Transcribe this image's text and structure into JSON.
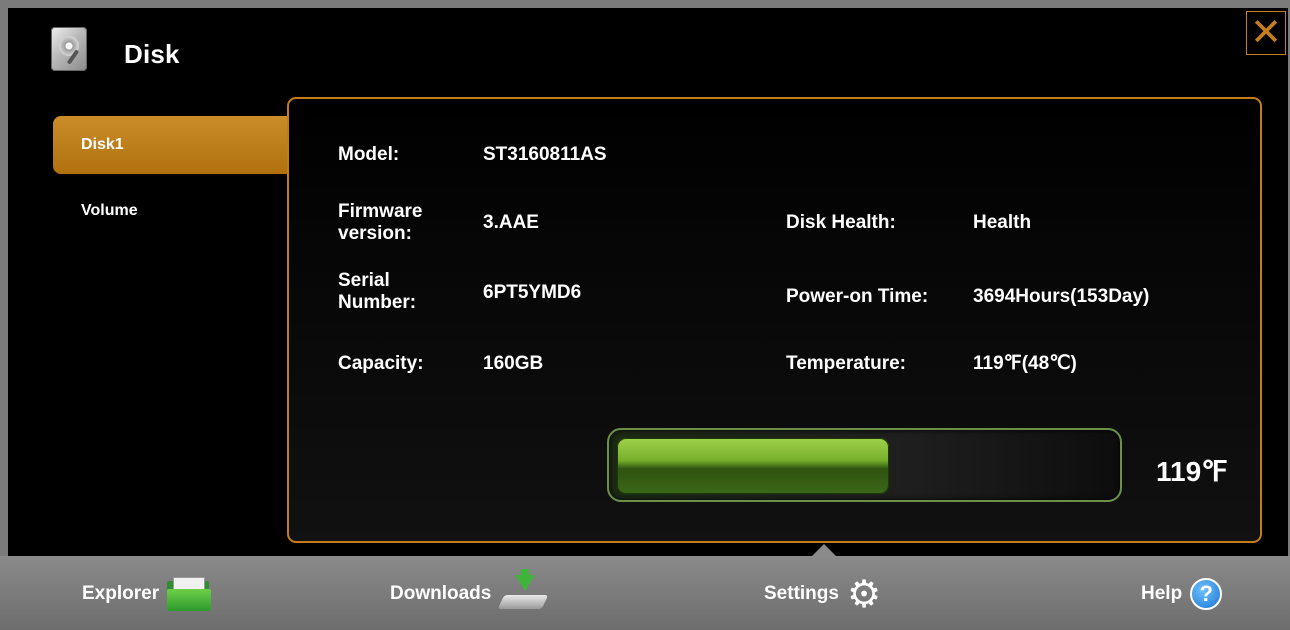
{
  "window": {
    "title": "Disk",
    "title_icon": "hard-disk-icon",
    "close_icon": "close-icon",
    "close_symbol": "✕"
  },
  "sidebar": {
    "items": [
      {
        "label": "Disk1",
        "active": true
      },
      {
        "label": "Volume",
        "active": false
      }
    ]
  },
  "disk": {
    "model_label": "Model:",
    "model_value": "ST3160811AS",
    "firmware_label": "Firmware version:",
    "firmware_value": "3.AAE",
    "serial_label": "Serial Number:",
    "serial_value": "6PT5YMD6",
    "capacity_label": "Capacity:",
    "capacity_value": "160GB",
    "health_label": "Disk Health:",
    "health_value": "Health",
    "power_label": "Power-on Time:",
    "power_value": "3694Hours(153Day)",
    "temperature_label": "Temperature:",
    "temperature_value": "119℉(48℃)"
  },
  "temperature_bar": {
    "fill_fraction": 0.55,
    "value_text": "119℉",
    "fill_color": "#77b02c"
  },
  "taskbar": {
    "items": [
      {
        "label": "Explorer",
        "icon": "folder-icon"
      },
      {
        "label": "Downloads",
        "icon": "download-icon"
      },
      {
        "label": "Settings",
        "icon": "gear-icon",
        "active": true
      },
      {
        "label": "Help",
        "icon": "help-icon",
        "symbol": "?"
      }
    ]
  },
  "colors": {
    "accent": "#c27c1a",
    "background": "#000000",
    "taskbar": "#7b7b7b"
  }
}
